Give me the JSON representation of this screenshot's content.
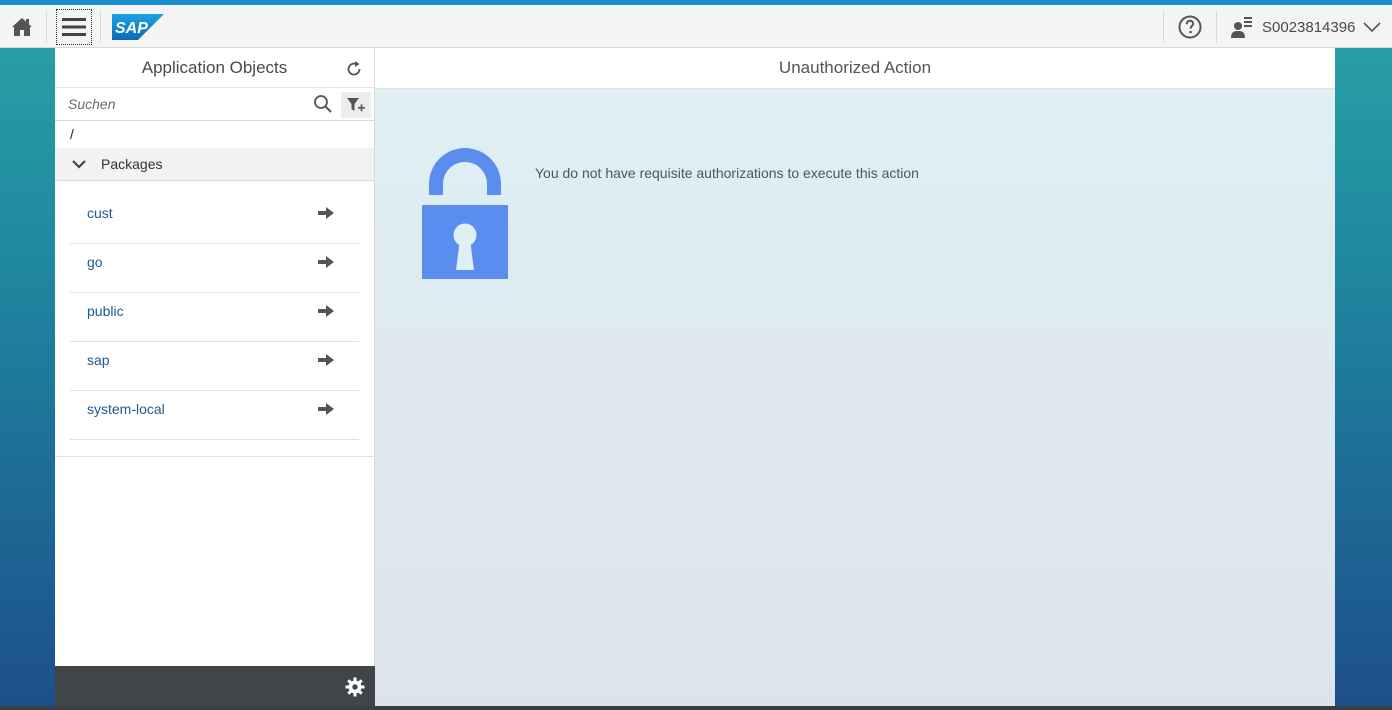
{
  "shell": {
    "user_name": "S0023814396",
    "logo_text": "SAP"
  },
  "left_panel": {
    "title": "Application Objects",
    "search_placeholder": "Suchen",
    "path": "/",
    "group_label": "Packages",
    "items": [
      {
        "label": "cust"
      },
      {
        "label": "go"
      },
      {
        "label": "public"
      },
      {
        "label": "sap"
      },
      {
        "label": "system-local"
      }
    ]
  },
  "main": {
    "title": "Unauthorized Action",
    "message": "You do not have requisite authorizations to execute this action"
  },
  "colors": {
    "accent": "#1c8fd3",
    "lock": "#5b8def",
    "link": "#1d5a8e",
    "footer": "#3f4548"
  }
}
